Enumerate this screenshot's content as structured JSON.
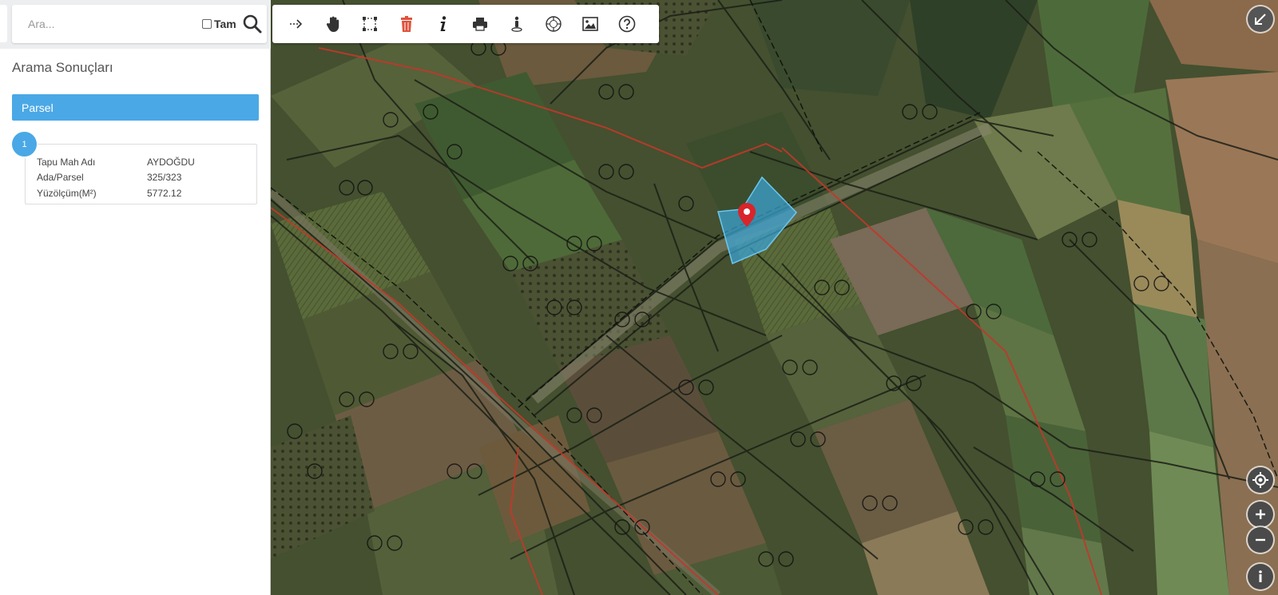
{
  "search": {
    "placeholder": "Ara...",
    "tam_label": "Tam"
  },
  "panel": {
    "title": "Arama Sonuçları",
    "section_header": "Parsel",
    "results": [
      {
        "index": "1",
        "fields": [
          {
            "label": "Tapu Mah Adı",
            "value": "AYDOĞDU"
          },
          {
            "label": "Ada/Parsel",
            "value": "325/323"
          },
          {
            "label": "Yüzölçüm(M²)",
            "value": "5772.12"
          }
        ]
      }
    ]
  },
  "toolbar": {
    "icons": [
      "arrow-right-dashed-icon",
      "hand-pan-icon",
      "select-rectangle-icon",
      "trash-icon",
      "info-icon",
      "print-icon",
      "person-pin-icon",
      "coordinate-icon",
      "image-icon",
      "help-icon"
    ]
  },
  "map_controls": {
    "icons": [
      "collapse-arrow-icon",
      "locate-icon",
      "zoom-in-icon",
      "zoom-out-icon",
      "info-icon"
    ]
  },
  "colors": {
    "accent": "#4aa8e6",
    "parcel_fill": "#3aa6dc",
    "marker": "#d9242b",
    "boundary_red": "#c0392b"
  }
}
